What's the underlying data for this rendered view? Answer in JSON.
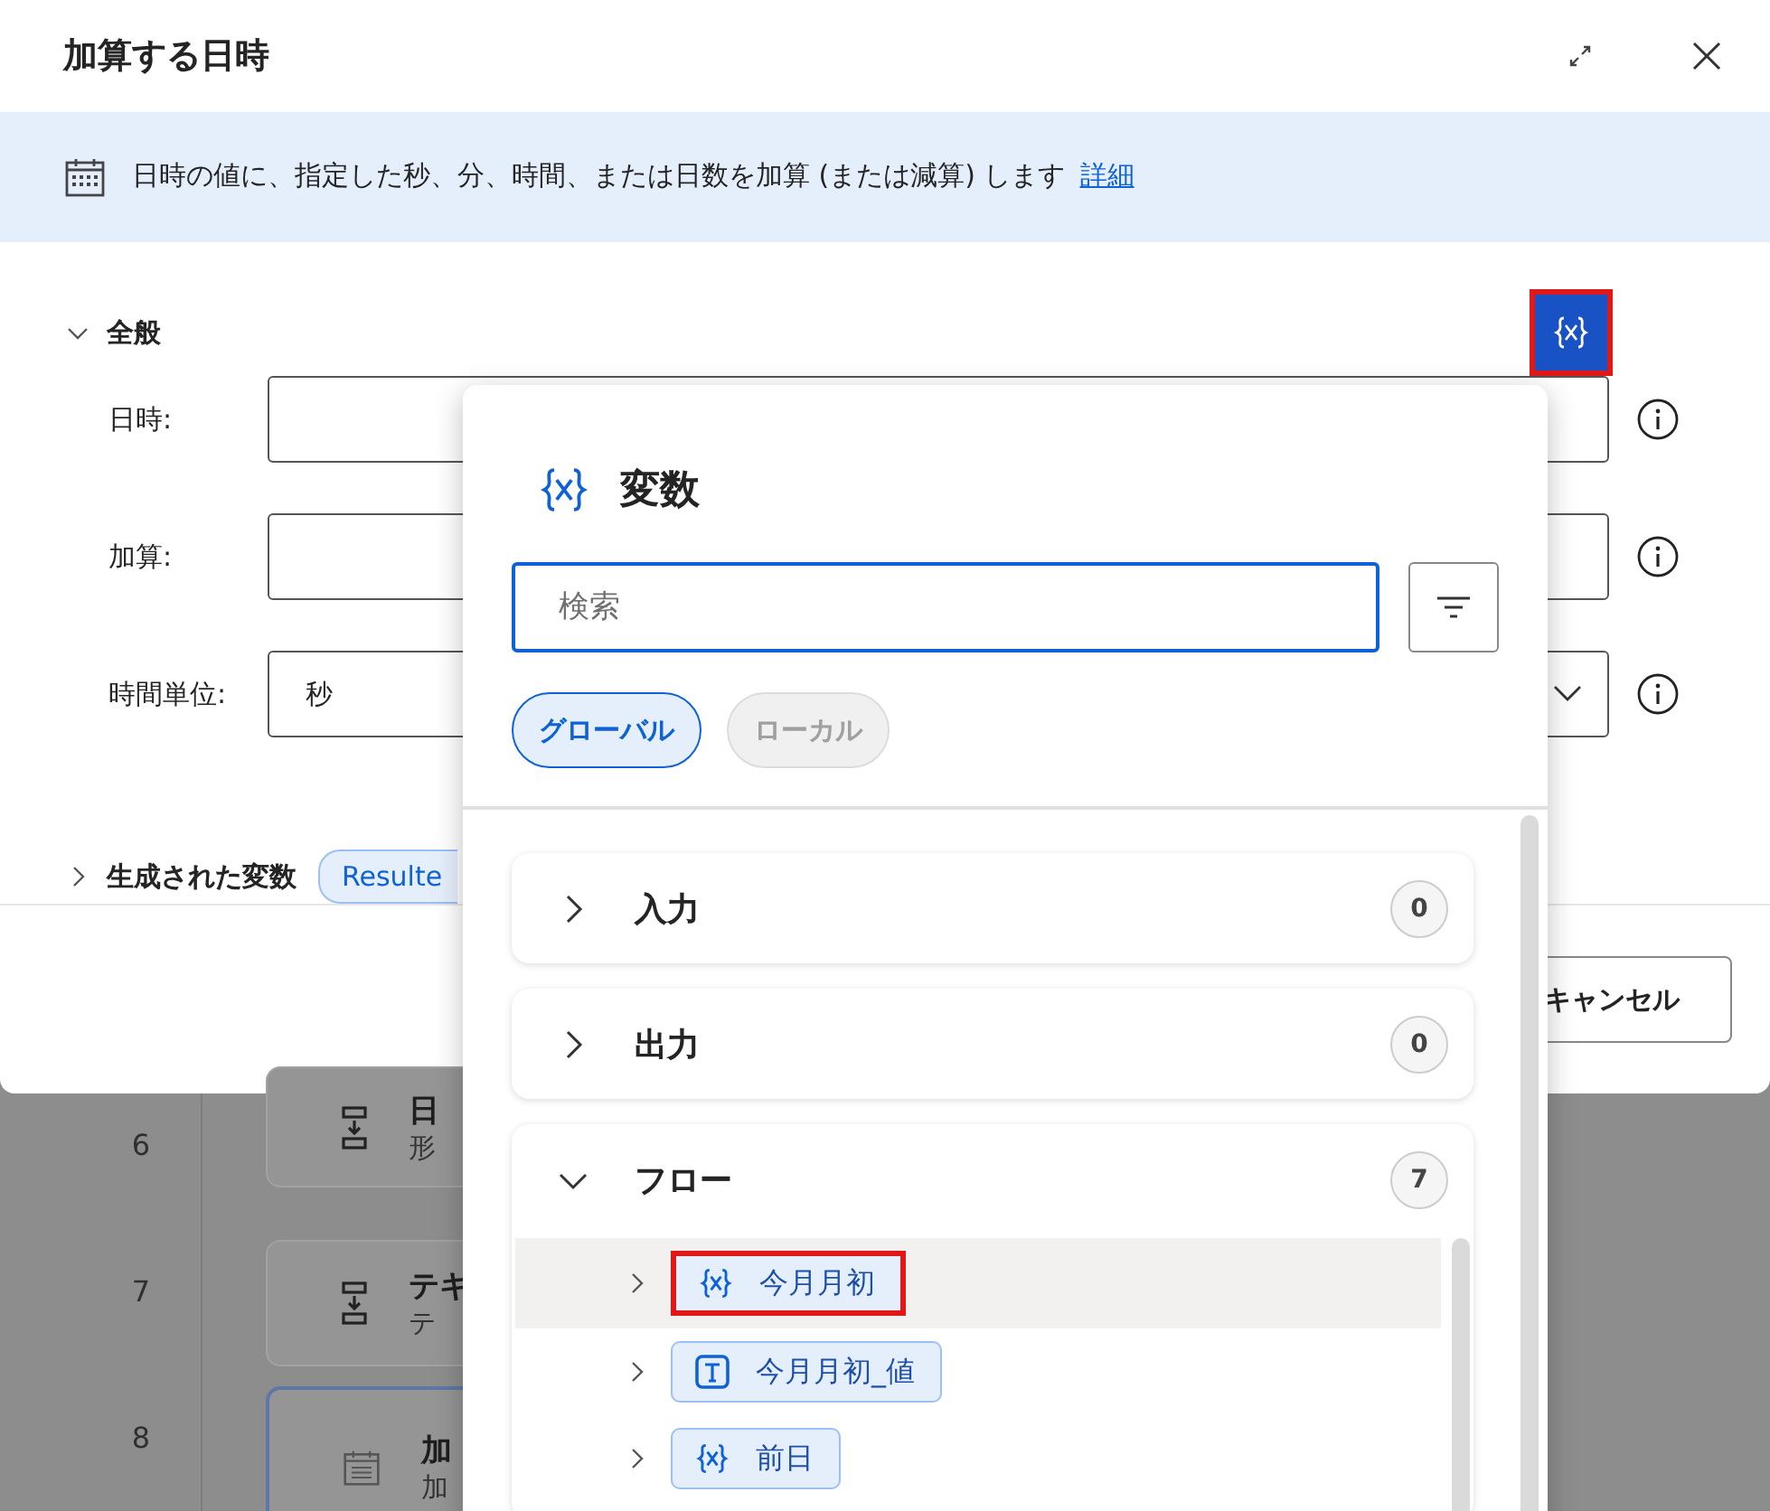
{
  "dialog": {
    "title": "加算する日時",
    "description": "日時の値に、指定した秒、分、時間、または日数を加算 (または減算) します",
    "link": "詳細",
    "general": {
      "label": "全般",
      "expanded": true
    },
    "variables_button": {
      "highlighted": true
    },
    "fields": [
      {
        "label": "日時:",
        "kind": "text"
      },
      {
        "label": "加算:",
        "kind": "text"
      },
      {
        "label": "時間単位:",
        "kind": "dropdown",
        "value": "秒"
      }
    ],
    "generated": {
      "label": "生成された変数",
      "expanded": false,
      "chip": "Resulte"
    },
    "buttons": [
      "キャンセル"
    ]
  },
  "flow_steps": [
    {
      "number": "6",
      "kind": "action",
      "title": "日",
      "subtitle": "形",
      "selected": false
    },
    {
      "number": "7",
      "kind": "action",
      "title": "テキ",
      "subtitle": "テ",
      "selected": false
    },
    {
      "number": "8",
      "kind": "calendar",
      "title": "加",
      "subtitle": "加",
      "selected": true
    }
  ],
  "variables_panel": {
    "title": "変数",
    "search": {
      "placeholder": "検索"
    },
    "scopes": [
      {
        "label": "グローバル",
        "selected": true
      },
      {
        "label": "ローカル",
        "selected": false
      }
    ],
    "groups": [
      {
        "label": "入力",
        "count": "0",
        "expanded": false
      },
      {
        "label": "出力",
        "count": "0",
        "expanded": false
      },
      {
        "label": "フロー",
        "count": "7",
        "expanded": true,
        "items": [
          {
            "name": "今月月初",
            "kind": "variable",
            "selected": true,
            "highlighted": true
          },
          {
            "name": "今月月初_値",
            "kind": "text",
            "selected": false,
            "highlighted": false
          },
          {
            "name": "前日",
            "kind": "variable",
            "selected": false,
            "highlighted": false
          }
        ]
      }
    ]
  }
}
